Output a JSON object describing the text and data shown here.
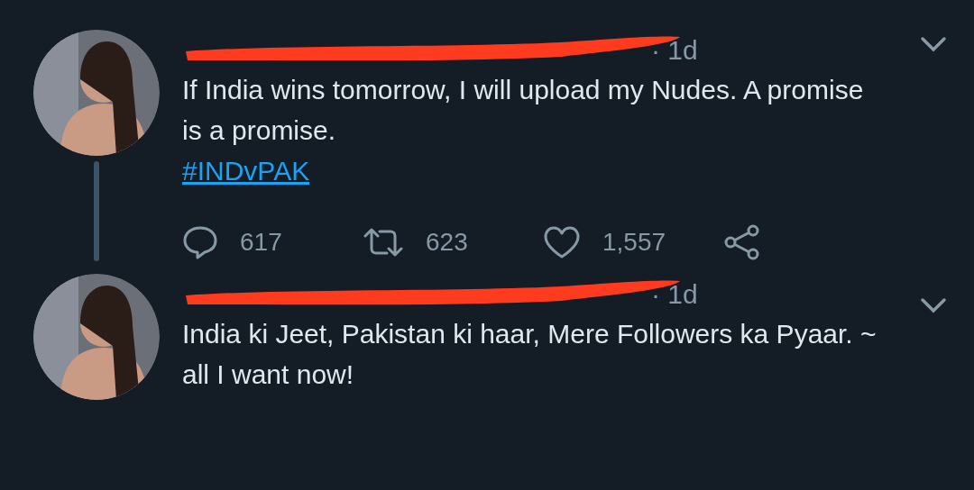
{
  "tweets": [
    {
      "time": "· 1d",
      "text": "If India wins tomorrow, I will upload my Nudes. A promise is a promise.",
      "hashtag": "#INDvPAK",
      "replies": "617",
      "retweets": "623",
      "likes": "1,557"
    },
    {
      "time": "· 1d",
      "text": "India ki Jeet, Pakistan ki haar, Mere Followers ka Pyaar. ~ all I want now!"
    }
  ]
}
